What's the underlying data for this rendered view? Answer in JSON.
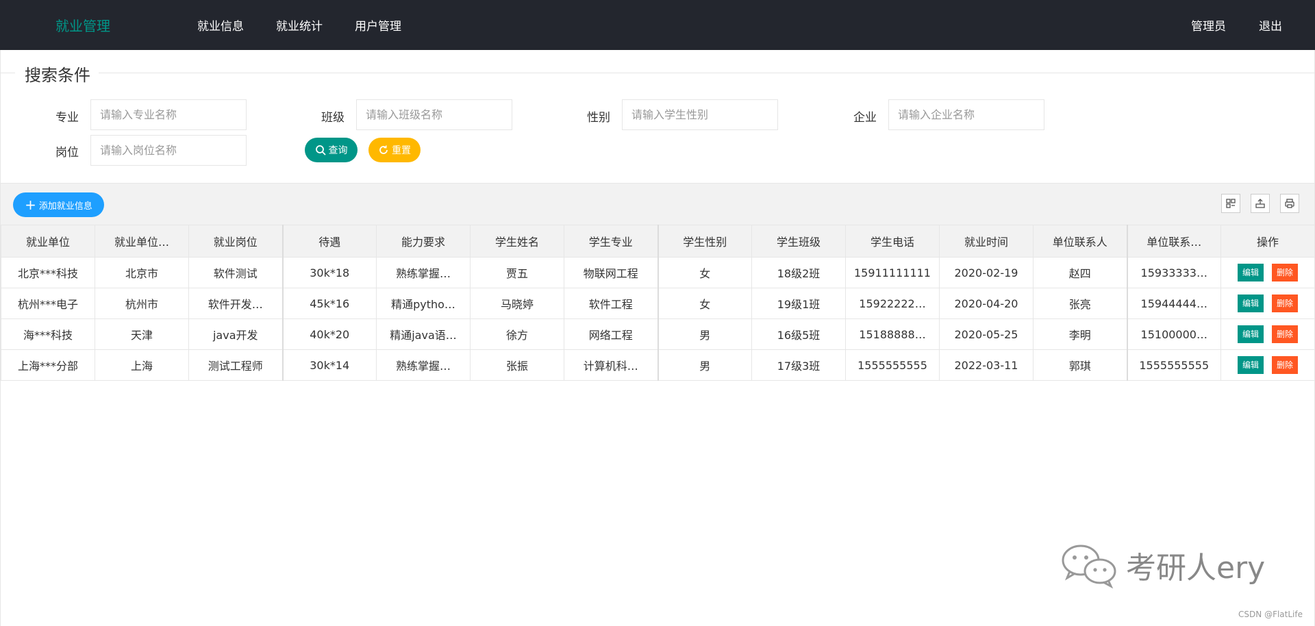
{
  "header": {
    "brand": "就业管理",
    "nav": [
      "就业信息",
      "就业统计",
      "用户管理"
    ],
    "user": "管理员",
    "logout": "退出"
  },
  "search": {
    "legend": "搜索条件",
    "fields": [
      {
        "label": "专业",
        "placeholder": "请输入专业名称"
      },
      {
        "label": "班级",
        "placeholder": "请输入班级名称"
      },
      {
        "label": "性别",
        "placeholder": "请输入学生性别"
      },
      {
        "label": "企业",
        "placeholder": "请输入企业名称"
      },
      {
        "label": "岗位",
        "placeholder": "请输入岗位名称"
      }
    ],
    "query_label": "查询",
    "reset_label": "重置"
  },
  "toolbar": {
    "add_label": "添加就业信息",
    "icons": [
      "columns-icon",
      "export-icon",
      "print-icon"
    ]
  },
  "table": {
    "headers": [
      "就业单位",
      "就业单位…",
      "就业岗位",
      "待遇",
      "能力要求",
      "学生姓名",
      "学生专业",
      "学生性别",
      "学生班级",
      "学生电话",
      "就业时间",
      "单位联系人",
      "单位联系…",
      "操作"
    ],
    "rows": [
      [
        "北京***科技",
        "北京市",
        "软件测试",
        "30k*18",
        "熟练掌握…",
        "贾五",
        "物联网工程",
        "女",
        "18级2班",
        "15911111111",
        "2020-02-19",
        "赵四",
        "15933333…"
      ],
      [
        "杭州***电子",
        "杭州市",
        "软件开发…",
        "45k*16",
        "精通pytho…",
        "马晓婷",
        "软件工程",
        "女",
        "19级1班",
        "15922222…",
        "2020-04-20",
        "张亮",
        "15944444…"
      ],
      [
        "海***科技",
        "天津",
        "java开发",
        "40k*20",
        "精通java语…",
        "徐方",
        "网络工程",
        "男",
        "16级5班",
        "15188888…",
        "2020-05-25",
        "李明",
        "15100000…"
      ],
      [
        "上海***分部",
        "上海",
        "测试工程师",
        "30k*14",
        "熟练掌握…",
        "张振",
        "计算机科…",
        "男",
        "17级3班",
        "1555555555",
        "2022-03-11",
        "郭琪",
        "1555555555"
      ]
    ],
    "edit_label": "编辑",
    "delete_label": "删除"
  },
  "watermark": "考研人ery",
  "credit": "CSDN @FlatLife",
  "colors": {
    "header_bg": "#23262e",
    "brand": "#009688",
    "query": "#009688",
    "reset": "#ffb800",
    "add": "#1e9fff",
    "edit": "#009688",
    "delete": "#ff5722"
  }
}
